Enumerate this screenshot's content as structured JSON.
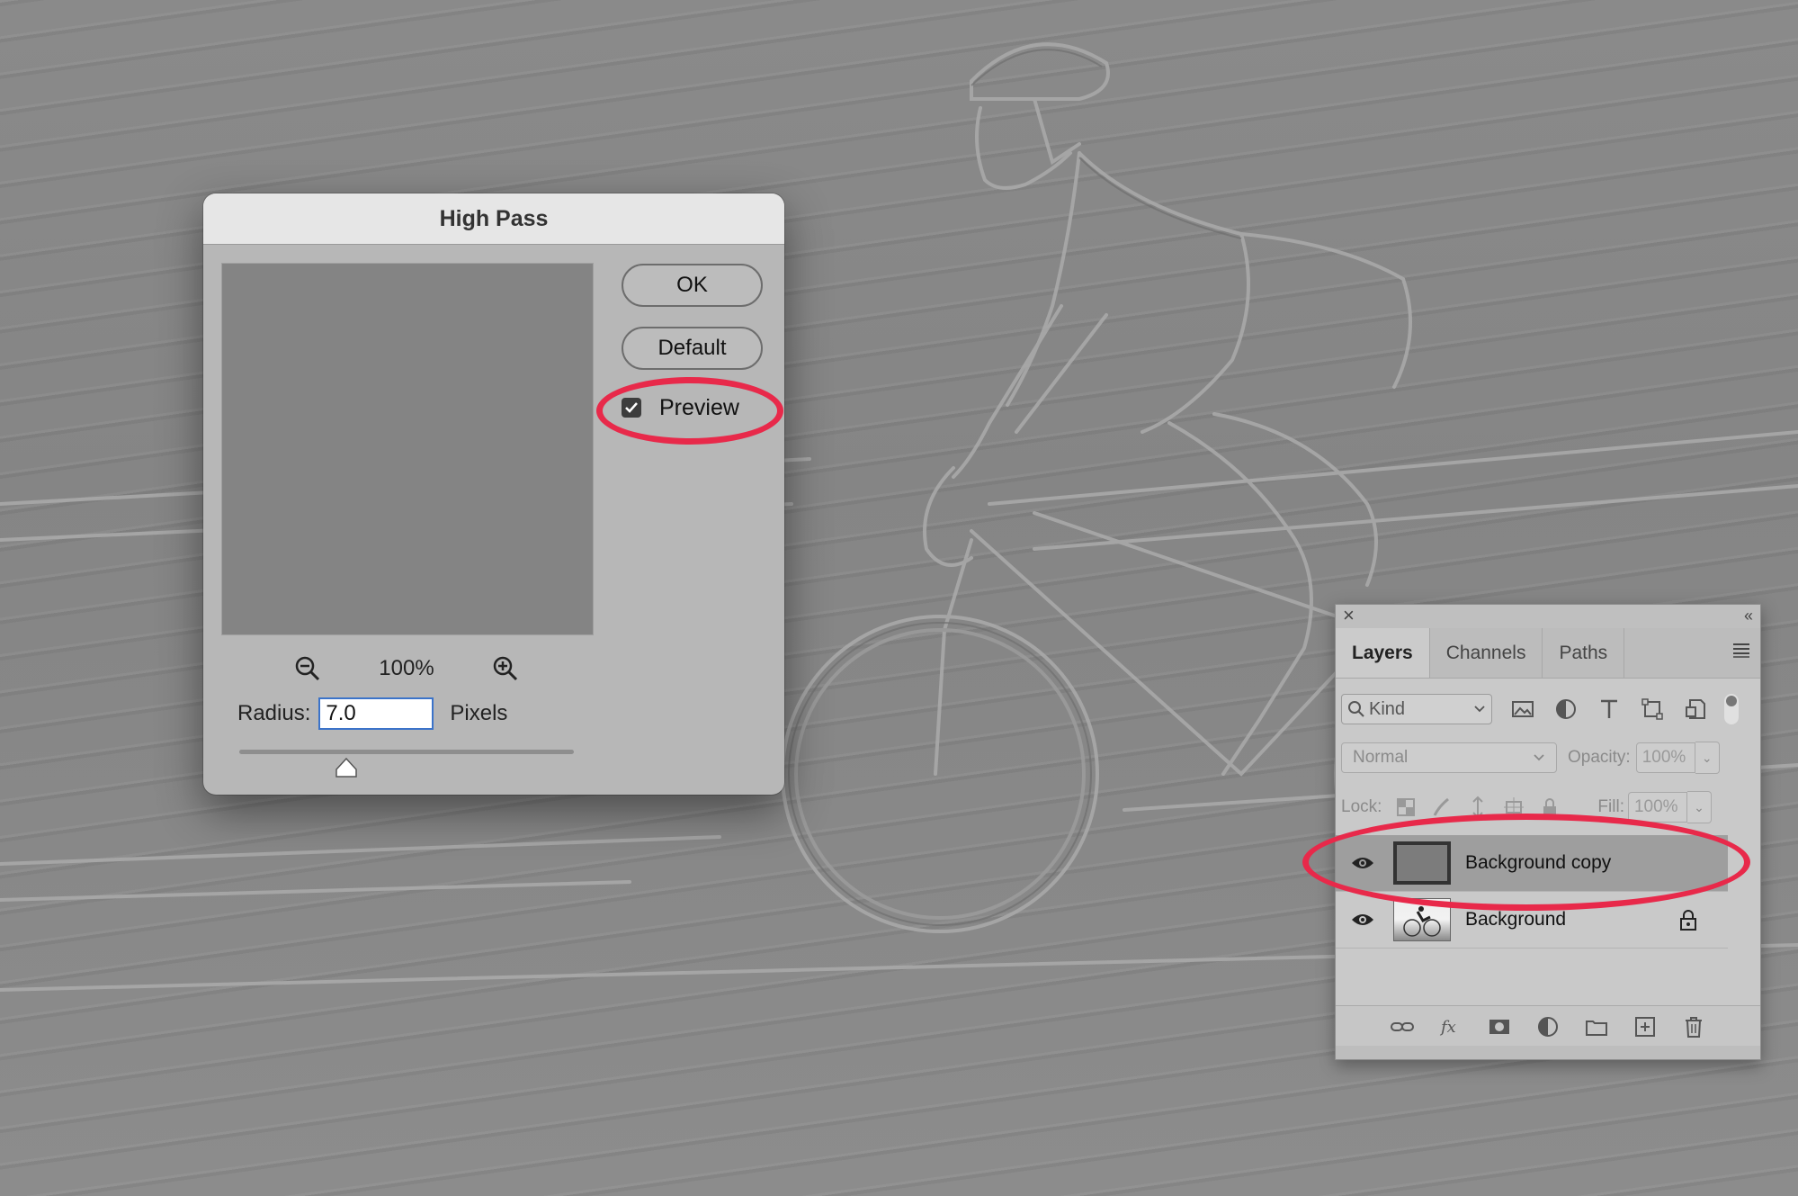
{
  "dialog": {
    "title": "High Pass",
    "ok_label": "OK",
    "default_label": "Default",
    "preview_label": "Preview",
    "preview_checked": true,
    "zoom_level": "100%",
    "radius_label": "Radius:",
    "radius_value": "7.0",
    "radius_unit": "Pixels"
  },
  "layers_panel": {
    "tabs": [
      "Layers",
      "Channels",
      "Paths"
    ],
    "active_tab": "Layers",
    "filter_kind": "Kind",
    "blend_mode": "Normal",
    "opacity_label": "Opacity:",
    "opacity_value": "100%",
    "lock_label": "Lock:",
    "fill_label": "Fill:",
    "fill_value": "100%",
    "layers": [
      {
        "name": "Background copy",
        "selected": true,
        "visible": true,
        "locked": false
      },
      {
        "name": "Background",
        "selected": false,
        "visible": true,
        "locked": true
      }
    ]
  },
  "colors": {
    "annotation_red": "#e8294a",
    "input_focus_blue": "#3b73c9"
  }
}
